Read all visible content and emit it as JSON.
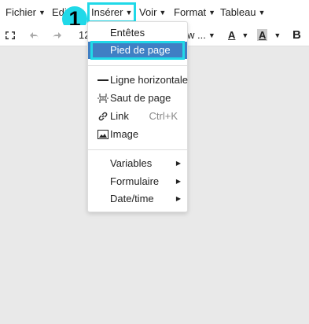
{
  "menubar": {
    "fichier": "Fichier",
    "edit": "Edit",
    "inserer": "Insérer",
    "voir": "Voir",
    "format": "Format",
    "tableau": "Tableau"
  },
  "toolbar": {
    "font_size": "12",
    "font_name": "w ...",
    "text_color": "A",
    "bg_color": "A",
    "bold": "B"
  },
  "badge": "1",
  "dropdown": {
    "entetes": "Entêtes",
    "pied_de_page": "Pied de page",
    "ligne_horizontale": "Ligne horizontale",
    "saut_de_page": "Saut de page",
    "link": "Link",
    "link_shortcut": "Ctrl+K",
    "image": "Image",
    "variables": "Variables",
    "formulaire": "Formulaire",
    "date_time": "Date/time"
  },
  "colors": {
    "highlight": "#20d9e8",
    "selected_bg": "#3f7fc4"
  }
}
